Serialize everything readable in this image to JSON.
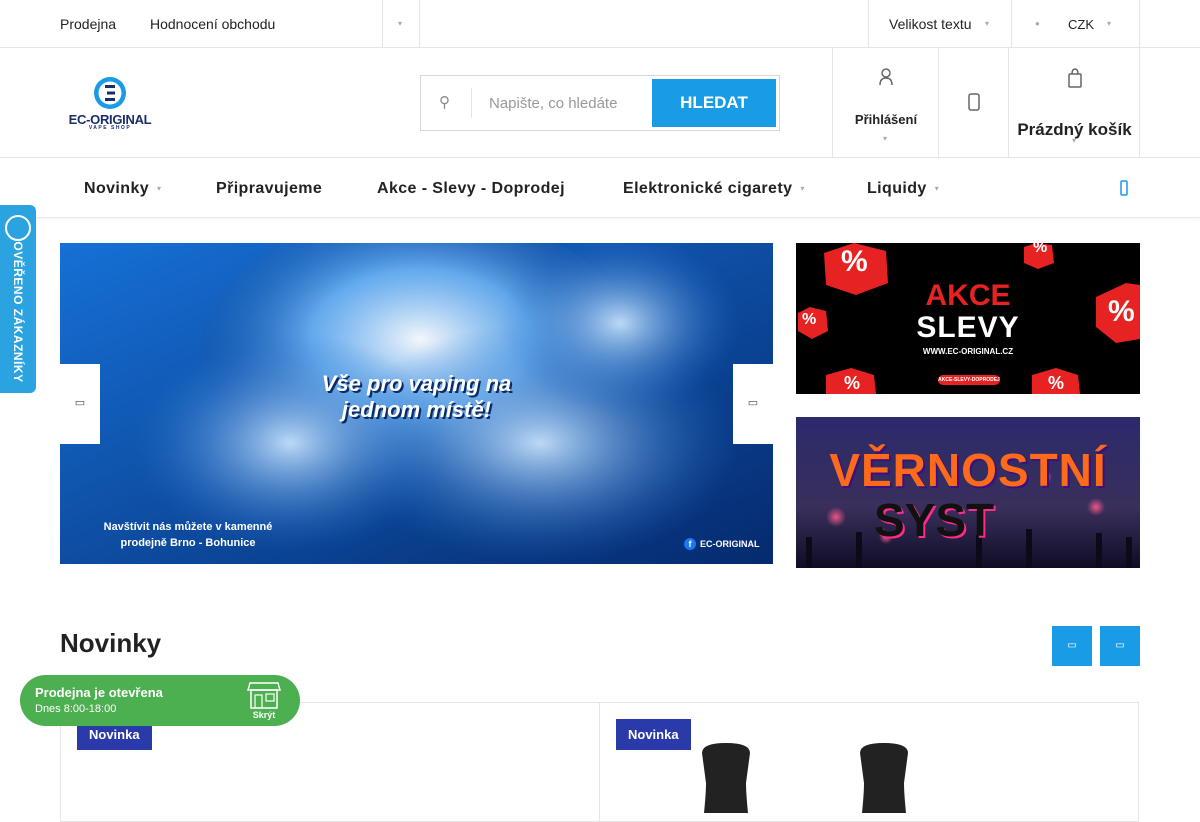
{
  "topbar": {
    "links": [
      "Prodejna",
      "Hodnocení obchodu"
    ],
    "font_size_label": "Velikost textu",
    "currency": "CZK"
  },
  "logo": {
    "name": "EC-ORIGINAL",
    "tagline": "VAPE SHOP"
  },
  "search": {
    "placeholder": "Napište, co hledáte",
    "button": "HLEDAT"
  },
  "account": {
    "login": "Přihlášení"
  },
  "cart": {
    "label": "Prázdný košík"
  },
  "nav": {
    "items": [
      "Novinky",
      "Připravujeme",
      "Akce - Slevy - Doprodej",
      "Elektronické cigarety",
      "Liquidy"
    ]
  },
  "hero": {
    "headline_1": "Vše pro vaping na",
    "headline_2": "jednom místě!",
    "sub_1": "Navštívit nás můžete v kamenné",
    "sub_2": "prodejně Brno - Bohunice",
    "brand": "EC-ORIGINAL"
  },
  "banner_sale": {
    "line1": "AKCE",
    "line2": "SLEVY",
    "url": "WWW.EC-ORIGINAL.CZ",
    "pill": "AKCE-SLEVY-DOPRODEJ",
    "percent": "%"
  },
  "banner_loyalty": {
    "line1": "VĚRNOSTNÍ",
    "line2": "SYST"
  },
  "side_badge": {
    "label": "OVĚŘENO ZÁKAZNÍKY"
  },
  "section": {
    "title": "Novinky"
  },
  "products": [
    {
      "tag": "Novinka"
    },
    {
      "tag": "Novinka"
    }
  ],
  "store_status": {
    "title": "Prodejna je otevřena",
    "hours": "Dnes 8:00-18:00",
    "hide": "Skrýt"
  },
  "colors": {
    "accent": "#1a9be6",
    "tag": "#2a3aa8",
    "store": "#4caf50"
  }
}
